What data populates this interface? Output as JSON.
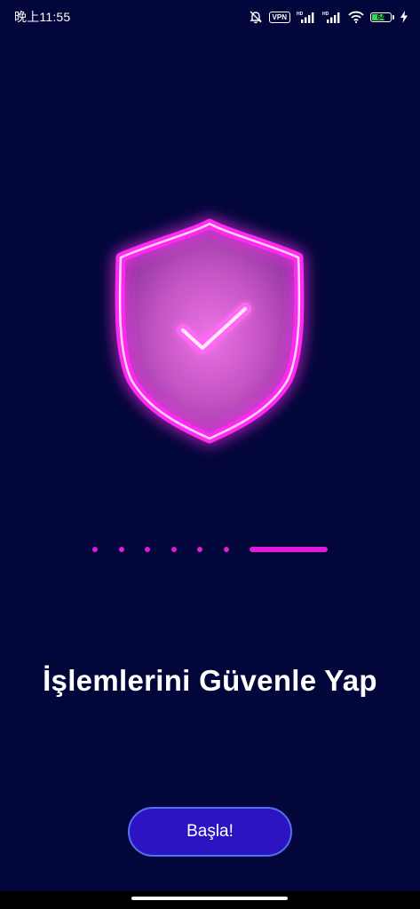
{
  "status_bar": {
    "time": "晚上11:55",
    "vpn_label": "VPN",
    "hd_label_1": "HD",
    "hd_label_2": "HD",
    "battery_level": "64",
    "icons": [
      "mute-bell-icon",
      "vpn-icon",
      "signal-icon",
      "signal-icon",
      "wifi-icon",
      "battery-icon",
      "charging-icon"
    ],
    "battery_color": "#39d353"
  },
  "hero": {
    "icon": "shield-check-icon",
    "glow_color": "#ff3cf0"
  },
  "pager": {
    "total_pages": 7,
    "current_page": 7,
    "color": "#e21ad8"
  },
  "headline": "İşlemlerini Güvenle Yap",
  "start_button": {
    "label": "Başla!",
    "background": "#2d14c2",
    "border": "#4f72f0"
  },
  "colors": {
    "background": "#02063a"
  }
}
